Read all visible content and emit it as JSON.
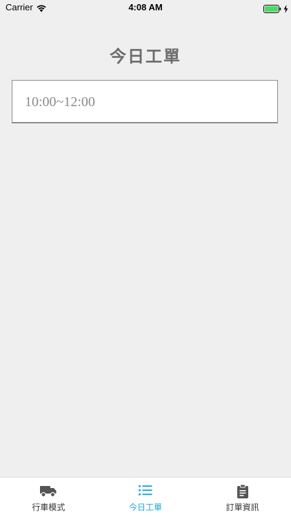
{
  "status_bar": {
    "carrier": "Carrier",
    "time": "4:08 AM",
    "icons": [
      "wifi-icon",
      "battery-icon",
      "charging-icon"
    ]
  },
  "page": {
    "title": "今日工單"
  },
  "orders": [
    {
      "time_range": "10:00~12:00"
    }
  ],
  "tab_bar": {
    "active_color": "#1fa5d8",
    "inactive_color": "#333333",
    "tabs": [
      {
        "label": "行車模式",
        "icon": "truck-icon",
        "active": false
      },
      {
        "label": "今日工單",
        "icon": "list-icon",
        "active": true
      },
      {
        "label": "訂單資訊",
        "icon": "clipboard-icon",
        "active": false
      }
    ]
  }
}
